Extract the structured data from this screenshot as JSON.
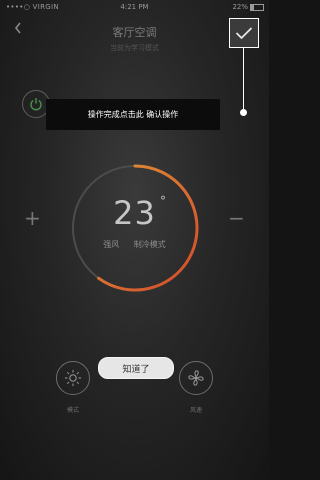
{
  "status_bar": {
    "carrier": "••••○ VIRGIN",
    "time": "4:21 PM",
    "battery": "22%"
  },
  "header": {
    "title": "客厅空调",
    "subtitle": "当前为学习模式"
  },
  "tooltip": {
    "text": "操作完成点击此 确认操作"
  },
  "thermostat": {
    "temperature": "23",
    "degree_symbol": "°",
    "wind": "强风",
    "mode": "制冷模式",
    "progress": 0.6
  },
  "controls": {
    "plus": "+",
    "minus": "−",
    "mode_label": "模式",
    "fan_label": "风速"
  },
  "gotit_button": {
    "label": "知道了"
  },
  "colors": {
    "accent": "#e0923a",
    "accent_end": "#d24a2a"
  }
}
